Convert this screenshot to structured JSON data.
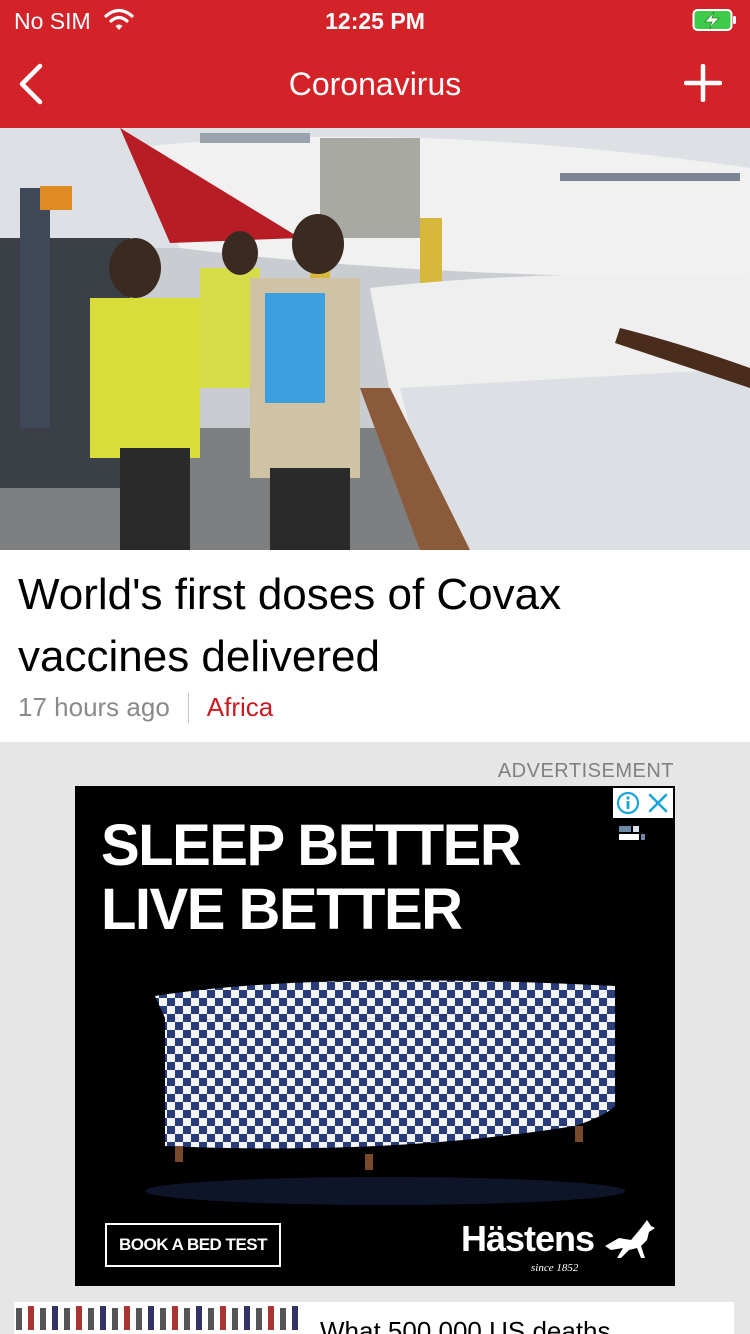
{
  "status_bar": {
    "carrier": "No SIM",
    "time": "12:25 PM",
    "wifi_icon": "wifi-icon",
    "battery_icon": "battery-charging-icon"
  },
  "nav": {
    "title": "Coronavirus",
    "back_icon": "chevron-left-icon",
    "add_icon": "plus-icon",
    "background": "#d42328"
  },
  "story": {
    "headline": "World's first doses of Covax vaccines delivered",
    "time_ago": "17 hours ago",
    "section": "Africa",
    "section_color": "#c81b21"
  },
  "ad": {
    "label": "ADVERTISEMENT",
    "headline": "SLEEP BETTER\nLIVE BETTER",
    "cta": "BOOK A BED TEST",
    "brand": "Hästens",
    "tagline": "since 1852",
    "info_icon": "info-icon",
    "close_icon": "close-icon"
  },
  "next_story": {
    "headline": "What 500,000 US deaths"
  }
}
